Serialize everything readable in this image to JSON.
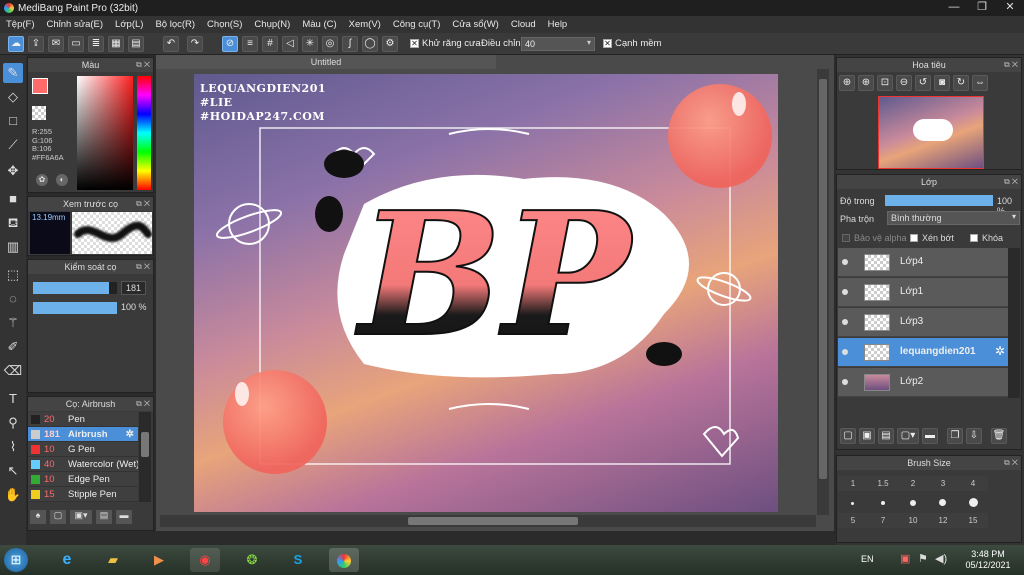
{
  "window": {
    "title": "MediBang Paint Pro (32bit)"
  },
  "menu": [
    "Tệp(F)",
    "Chỉnh sửa(E)",
    "Lớp(L)",
    "Bộ lọc(R)",
    "Chọn(S)",
    "Chụp(N)",
    "Màu (C)",
    "Xem(V)",
    "Công cụ(T)",
    "Cửa sổ(W)",
    "Cloud",
    "Help"
  ],
  "toolbar": {
    "antialias_label": "Khử răng cưa",
    "adjust_label": "Điều chỉnh",
    "adjust_value": "40",
    "edge_label": "Cạnh mềm",
    "antialias_checked": "✕",
    "edge_checked": "✕"
  },
  "document": {
    "tab_title": "Untitled"
  },
  "color_panel": {
    "title": "Màu",
    "r": "R:255",
    "g": "G:106",
    "b": "B:106",
    "hex": "#FF6A6A",
    "fg_color": "#ff6a6a"
  },
  "brush_preview": {
    "title": "Xem trước cọ",
    "size": "13.19mm"
  },
  "brush_control": {
    "title": "Kiểm soát cọ",
    "size_value": "181",
    "opacity_value": "100 %",
    "size_fraction": 0.9,
    "opacity_fraction": 1.0
  },
  "brush_list": {
    "title": "Cọ: Airbrush",
    "items": [
      {
        "size": "20",
        "name": "Pen",
        "color": "#222222"
      },
      {
        "size": "181",
        "name": "Airbrush",
        "color": "#cccccc"
      },
      {
        "size": "10",
        "name": "G Pen",
        "color": "#ee3333"
      },
      {
        "size": "40",
        "name": "Watercolor (Wet)",
        "color": "#66ccff"
      },
      {
        "size": "10",
        "name": "Edge Pen",
        "color": "#33aa33"
      },
      {
        "size": "15",
        "name": "Stipple Pen",
        "color": "#eecc22"
      }
    ]
  },
  "artwork": {
    "watermark": [
      "LEQUANGDIEN201",
      "#LIE",
      "#HOIDAP247.COM"
    ],
    "lettering": "BP"
  },
  "navigator": {
    "title": "Hoa tiêu"
  },
  "layers_panel": {
    "title": "Lớp",
    "opacity_label": "Độ trong",
    "opacity_value": "100 %",
    "opacity_fraction": 1.0,
    "blend_label": "Pha trộn",
    "blend_value": "Bình thường",
    "protect_alpha": "Bảo vệ alpha",
    "clipping": "Xén bớt",
    "lock": "Khóa",
    "layers": [
      {
        "name": "Lớp4"
      },
      {
        "name": "Lớp1"
      },
      {
        "name": "Lớp3"
      },
      {
        "name": "lequangdien201"
      },
      {
        "name": "Lớp2"
      }
    ]
  },
  "brush_size_panel": {
    "title": "Brush Size",
    "top_row": [
      "1",
      "1.5",
      "2",
      "3",
      "4"
    ],
    "bottom_row": [
      "5",
      "7",
      "10",
      "12",
      "15"
    ]
  },
  "taskbar": {
    "language": "EN",
    "time": "3:48 PM",
    "date": "05/12/2021"
  }
}
